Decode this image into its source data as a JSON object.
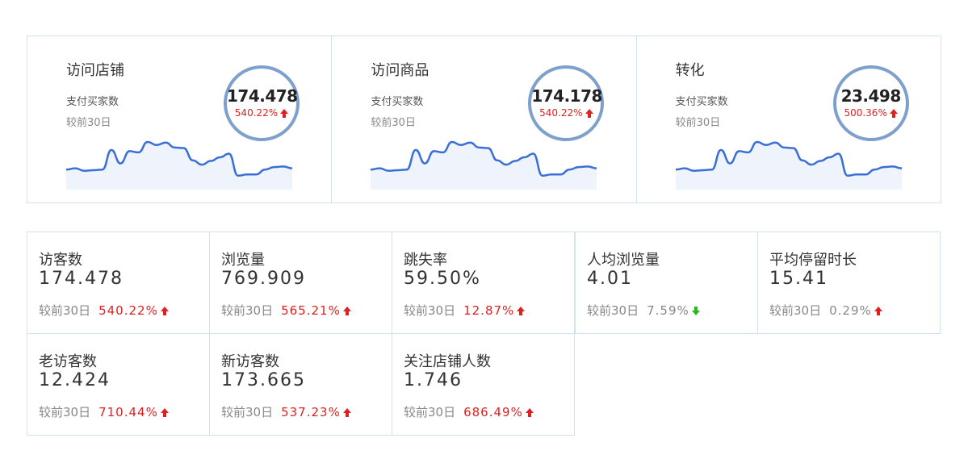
{
  "top_cards": [
    {
      "title": "访问店铺",
      "subtitle": "支付买家数",
      "compare_label": "较前30日",
      "value": "174.478",
      "change": "540.22%",
      "direction": "up"
    },
    {
      "title": "访问商品",
      "subtitle": "支付买家数",
      "compare_label": "较前30日",
      "value": "174.178",
      "change": "540.22%",
      "direction": "up"
    },
    {
      "title": "转化",
      "subtitle": "支付买家数",
      "compare_label": "较前30日",
      "value": "23.498",
      "change": "500.36%",
      "direction": "up"
    }
  ],
  "sparkline": {
    "color": "#3a6fd8",
    "fill": "#eef3fc",
    "values": [
      30,
      32,
      28,
      29,
      30,
      62,
      40,
      60,
      58,
      75,
      70,
      74,
      66,
      65,
      45,
      38,
      44,
      50,
      56,
      20,
      22,
      22,
      30,
      34,
      35,
      32
    ]
  },
  "metrics": [
    {
      "name": "访客数",
      "value": "174.478",
      "compare_label": "较前30日",
      "change": "540.22%",
      "direction": "up"
    },
    {
      "name": "浏览量",
      "value": "769.909",
      "compare_label": "较前30日",
      "change": "565.21%",
      "direction": "up"
    },
    {
      "name": "跳失率",
      "value": "59.50%",
      "compare_label": "较前30日",
      "change": "12.87%",
      "direction": "up"
    },
    {
      "name": "人均浏览量",
      "value": "4.01",
      "compare_label": "较前30日",
      "change": "7.59%",
      "direction": "down"
    },
    {
      "name": "平均停留时长",
      "value": "15.41",
      "compare_label": "较前30日",
      "change": "0.29%",
      "direction": "up-neutral"
    },
    {
      "name": "老访客数",
      "value": "12.424",
      "compare_label": "较前30日",
      "change": "710.44%",
      "direction": "up"
    },
    {
      "name": "新访客数",
      "value": "173.665",
      "compare_label": "较前30日",
      "change": "537.23%",
      "direction": "up"
    },
    {
      "name": "关注店铺人数",
      "value": "1.746",
      "compare_label": "较前30日",
      "change": "686.49%",
      "direction": "up"
    }
  ],
  "colors": {
    "up": "#e02020",
    "down": "#22bb22",
    "border": "#cfe3f5",
    "circle": "#7da1cc"
  }
}
